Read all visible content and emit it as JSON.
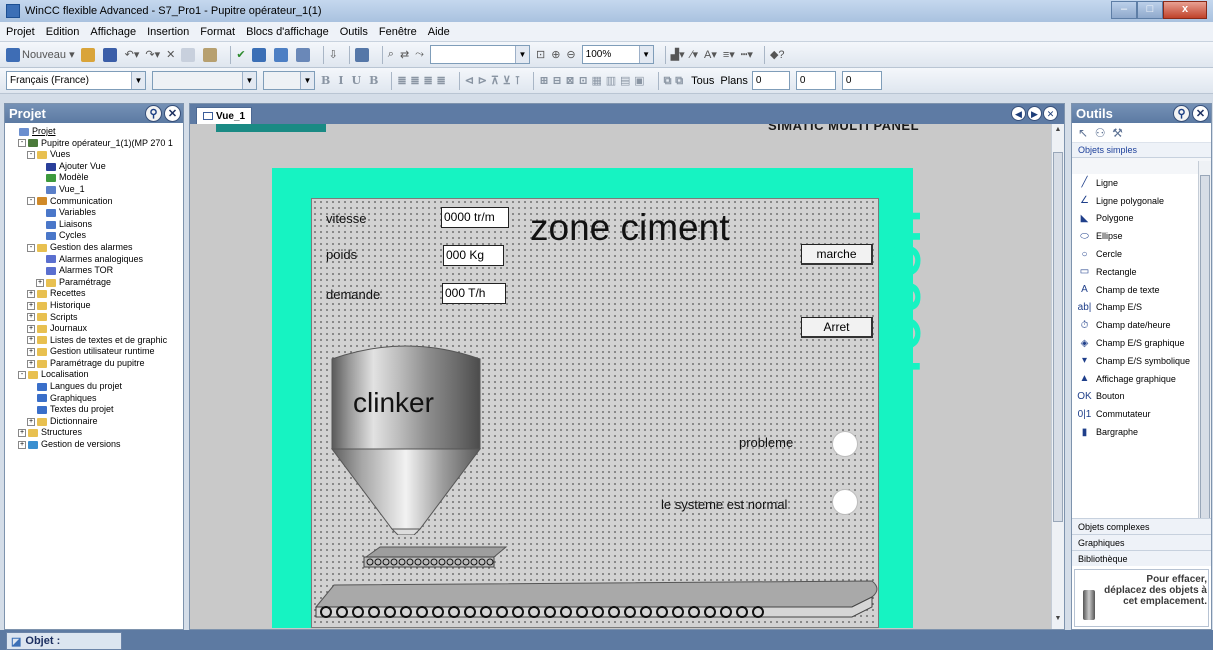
{
  "window": {
    "title": "WinCC flexible Advanced - S7_Pro1 - Pupitre opérateur_1(1)",
    "buttons": [
      "–",
      "□",
      "x"
    ]
  },
  "menu": [
    "Projet",
    "Edition",
    "Affichage",
    "Insertion",
    "Format",
    "Blocs d'affichage",
    "Outils",
    "Fenêtre",
    "Aide"
  ],
  "toolbar1": {
    "new_label": "Nouveau",
    "zoom": "100%"
  },
  "toolbar2": {
    "language": "Français (France)",
    "tous": "Tous",
    "plans": "Plans",
    "layer_value": "0",
    "spin1": "0",
    "spin2": "0"
  },
  "project_pane": {
    "title": "Projet",
    "items": [
      {
        "label": "Projet",
        "depth": 0,
        "exp": "",
        "icon": "project-icon",
        "color": "#6b8fcf"
      },
      {
        "label": "Pupitre opérateur_1(1)(MP 270 1",
        "depth": 1,
        "exp": "-",
        "icon": "hmi-icon",
        "color": "#4b7a3a"
      },
      {
        "label": "Vues",
        "depth": 2,
        "exp": "-",
        "icon": "folder-icon",
        "color": "#e8c050"
      },
      {
        "label": "Ajouter Vue",
        "depth": 3,
        "exp": "",
        "icon": "add-screen-icon",
        "color": "#2a3f9a"
      },
      {
        "label": "Modèle",
        "depth": 3,
        "exp": "",
        "icon": "template-icon",
        "color": "#3d9a3d"
      },
      {
        "label": "Vue_1",
        "depth": 3,
        "exp": "",
        "icon": "screen-icon",
        "color": "#5a7fc9"
      },
      {
        "label": "Communication",
        "depth": 2,
        "exp": "-",
        "icon": "communication-icon",
        "color": "#d08a2a"
      },
      {
        "label": "Variables",
        "depth": 3,
        "exp": "",
        "icon": "variables-icon",
        "color": "#4a77c9"
      },
      {
        "label": "Liaisons",
        "depth": 3,
        "exp": "",
        "icon": "connections-icon",
        "color": "#4a77c9"
      },
      {
        "label": "Cycles",
        "depth": 3,
        "exp": "",
        "icon": "cycles-icon",
        "color": "#4a77c9"
      },
      {
        "label": "Gestion des alarmes",
        "depth": 2,
        "exp": "-",
        "icon": "alarms-folder-icon",
        "color": "#e8c050"
      },
      {
        "label": "Alarmes analogiques",
        "depth": 3,
        "exp": "",
        "icon": "analog-alarm-icon",
        "color": "#5a6fcf"
      },
      {
        "label": "Alarmes TOR",
        "depth": 3,
        "exp": "",
        "icon": "discrete-alarm-icon",
        "color": "#5a6fcf"
      },
      {
        "label": "Paramétrage",
        "depth": 3,
        "exp": "+",
        "icon": "settings-folder-icon",
        "color": "#e8c050"
      },
      {
        "label": "Recettes",
        "depth": 2,
        "exp": "+",
        "icon": "recipes-icon",
        "color": "#e8c050"
      },
      {
        "label": "Historique",
        "depth": 2,
        "exp": "+",
        "icon": "history-icon",
        "color": "#e8c050"
      },
      {
        "label": "Scripts",
        "depth": 2,
        "exp": "+",
        "icon": "scripts-icon",
        "color": "#e8c050"
      },
      {
        "label": "Journaux",
        "depth": 2,
        "exp": "+",
        "icon": "logs-icon",
        "color": "#e8c050"
      },
      {
        "label": "Listes de textes et de graphic",
        "depth": 2,
        "exp": "+",
        "icon": "text-lists-icon",
        "color": "#e8c050"
      },
      {
        "label": "Gestion utilisateur runtime",
        "depth": 2,
        "exp": "+",
        "icon": "user-admin-icon",
        "color": "#e8c050"
      },
      {
        "label": "Paramétrage du pupitre",
        "depth": 2,
        "exp": "+",
        "icon": "device-settings-icon",
        "color": "#e8c050"
      },
      {
        "label": "Localisation",
        "depth": 1,
        "exp": "-",
        "icon": "localization-icon",
        "color": "#e8c050"
      },
      {
        "label": "Langues du projet",
        "depth": 2,
        "exp": "",
        "icon": "languages-icon",
        "color": "#3a6fc9"
      },
      {
        "label": "Graphiques",
        "depth": 2,
        "exp": "",
        "icon": "graphics-icon",
        "color": "#3a6fc9"
      },
      {
        "label": "Textes du projet",
        "depth": 2,
        "exp": "",
        "icon": "project-texts-icon",
        "color": "#3a6fc9"
      },
      {
        "label": "Dictionnaire",
        "depth": 2,
        "exp": "+",
        "icon": "dictionary-icon",
        "color": "#e8c050"
      },
      {
        "label": "Structures",
        "depth": 1,
        "exp": "+",
        "icon": "structures-icon",
        "color": "#e8c050"
      },
      {
        "label": "Gestion de versions",
        "depth": 1,
        "exp": "+",
        "icon": "versions-icon",
        "color": "#3a8fd0"
      }
    ]
  },
  "editor": {
    "tab_label": "Vue_1"
  },
  "hmi": {
    "panel_brand": "SIMATIC MULTI PANEL",
    "touch_label": "TOUCH",
    "title": "zone ciment",
    "vitesse_label": "vitesse",
    "vitesse_value": "0000 tr/m",
    "poids_label": "poids",
    "poids_value": "000   Kg",
    "demande_label": "demande",
    "demande_value": "000  T/h",
    "marche_button": "marche",
    "arret_button": "Arret",
    "silo_label": "clinker",
    "probleme_label": "probleme",
    "normal_label": "le systeme est normal"
  },
  "tools_pane": {
    "title": "Outils",
    "section": "Objets simples",
    "items": [
      {
        "label": "Ligne",
        "icon": "line-icon",
        "glyph": "╱"
      },
      {
        "label": "Ligne polygonale",
        "icon": "polyline-icon",
        "glyph": "∠"
      },
      {
        "label": "Polygone",
        "icon": "polygon-icon",
        "glyph": "◣"
      },
      {
        "label": "Ellipse",
        "icon": "ellipse-icon",
        "glyph": "⬭"
      },
      {
        "label": "Cercle",
        "icon": "circle-icon",
        "glyph": "○"
      },
      {
        "label": "Rectangle",
        "icon": "rectangle-icon",
        "glyph": "▭"
      },
      {
        "label": "Champ de texte",
        "icon": "text-field-icon",
        "glyph": "A"
      },
      {
        "label": "Champ E/S",
        "icon": "io-field-icon",
        "glyph": "ab|"
      },
      {
        "label": "Champ date/heure",
        "icon": "datetime-field-icon",
        "glyph": "⏱"
      },
      {
        "label": "Champ E/S graphique",
        "icon": "graphic-io-field-icon",
        "glyph": "◈"
      },
      {
        "label": "Champ E/S symbolique",
        "icon": "symbolic-io-field-icon",
        "glyph": "▾"
      },
      {
        "label": "Affichage graphique",
        "icon": "graphic-view-icon",
        "glyph": "▲"
      },
      {
        "label": "Bouton",
        "icon": "button-icon",
        "glyph": "OK"
      },
      {
        "label": "Commutateur",
        "icon": "switch-icon",
        "glyph": "0|1"
      },
      {
        "label": "Bargraphe",
        "icon": "bargraph-icon",
        "glyph": "▮"
      }
    ],
    "bottom_sections": [
      "Objets complexes",
      "Graphiques",
      "Bibliothèque"
    ],
    "trash_text": "Pour effacer, déplacez des objets à cet emplacement."
  },
  "status": {
    "object_label": "Objet :"
  }
}
